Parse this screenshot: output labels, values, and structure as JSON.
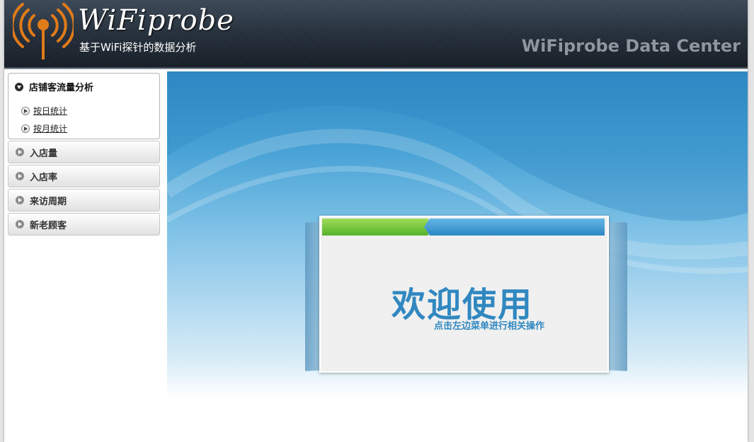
{
  "header": {
    "logo_title": "WiFiprobe",
    "logo_subtitle": "基于WiFi探针的数据分析",
    "right_title": "WiFiprobe Data Center",
    "colors": {
      "antenna": "#e07b1a",
      "text": "#ffffff",
      "right_text": "#8e969f"
    }
  },
  "sidebar": {
    "open_group": {
      "label": "店铺客流量分析",
      "icon": "circle-down-icon",
      "items": [
        {
          "label": "按日统计",
          "icon": "play-bullet-icon"
        },
        {
          "label": "按月统计",
          "icon": "play-bullet-icon"
        }
      ]
    },
    "groups": [
      {
        "label": "入店量",
        "icon": "circle-right-icon"
      },
      {
        "label": "入店率",
        "icon": "circle-right-icon"
      },
      {
        "label": "来访周期",
        "icon": "circle-right-icon"
      },
      {
        "label": "新老顾客",
        "icon": "circle-right-icon"
      }
    ]
  },
  "main": {
    "welcome_title": "欢迎使用",
    "welcome_subtitle": "点击左边菜单进行相关操作",
    "colors": {
      "accent": "#3188c0",
      "green_bar": "#55b22a",
      "blue_bar": "#2b86c4"
    }
  }
}
